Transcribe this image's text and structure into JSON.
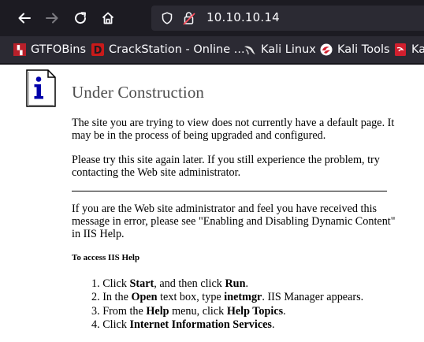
{
  "browser": {
    "url": "10.10.10.14",
    "bookmarks": [
      {
        "label": "GTFOBins",
        "icon": "gtfobins-icon"
      },
      {
        "label": "CrackStation - Online ...",
        "icon": "crackstation-icon"
      },
      {
        "label": "Kali Linux",
        "icon": "kali-dragon-icon"
      },
      {
        "label": "Kali Tools",
        "icon": "kali-tools-icon"
      },
      {
        "label": "Kal",
        "icon": "kali-docs-icon"
      }
    ]
  },
  "page": {
    "title": "Under Construction",
    "p1": "The site you are trying to view does not currently have a default page. It may be in the process of being upgraded and configured.",
    "p2": "Please try this site again later. If you still experience the problem, try contacting the Web site administrator.",
    "p3": "If you are the Web site administrator and feel you have received this message in error, please see \"Enabling and Disabling Dynamic Content\" in IIS Help.",
    "help_heading": "To access IIS Help",
    "steps": [
      {
        "num": "1.",
        "a": "Click ",
        "b1": "Start",
        "c": ", and then click ",
        "b2": "Run",
        "d": "."
      },
      {
        "num": "2.",
        "a": "In the ",
        "b1": "Open",
        "c": " text box, type ",
        "b2": "inetmgr",
        "d": ". IIS Manager appears."
      },
      {
        "num": "3.",
        "a": "From the ",
        "b1": "Help",
        "c": " menu, click ",
        "b2": "Help Topics",
        "d": "."
      },
      {
        "num": "4.",
        "a": "Click ",
        "b1": "Internet Information Services",
        "c": "",
        "b2": "",
        "d": "."
      }
    ]
  },
  "colors": {
    "chrome_bg": "#1c1b22",
    "bookmarks_bg": "#2b2a33",
    "title_gray": "#4e4e4e",
    "icon_blue": "#0000aa"
  }
}
